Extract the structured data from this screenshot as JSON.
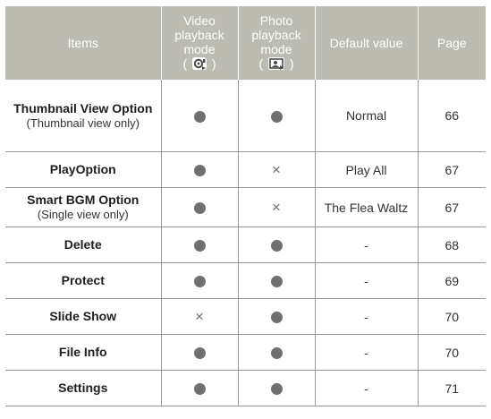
{
  "header": {
    "items": "Items",
    "video_line1": "Video",
    "video_line2": "playback",
    "video_line3": "mode",
    "video_open": "(",
    "video_close": ")",
    "photo_line1": "Photo",
    "photo_line2": "playback",
    "photo_line3": "mode",
    "photo_open": "(",
    "photo_close": ")",
    "default_value": "Default value",
    "page": "Page"
  },
  "symbols": {
    "supported": "dot",
    "unsupported": "×"
  },
  "colors": {
    "header_bg": "#bdbcb2",
    "header_text": "#ffffff",
    "marker": "#6f6f6f"
  },
  "rows": [
    {
      "name": "Thumbnail View Option",
      "note": "(Thumbnail view only)",
      "video": "supported",
      "photo": "supported",
      "default": "Normal",
      "page": "66"
    },
    {
      "name": "PlayOption",
      "note": "",
      "video": "supported",
      "photo": "unsupported",
      "default": "Play All",
      "page": "67"
    },
    {
      "name": "Smart BGM Option",
      "note": "(Single view only)",
      "video": "supported",
      "photo": "unsupported",
      "default": "The Flea Waltz",
      "page": "67"
    },
    {
      "name": "Delete",
      "note": "",
      "video": "supported",
      "photo": "supported",
      "default": "-",
      "page": "68"
    },
    {
      "name": "Protect",
      "note": "",
      "video": "supported",
      "photo": "supported",
      "default": "-",
      "page": "69"
    },
    {
      "name": "Slide Show",
      "note": "",
      "video": "unsupported",
      "photo": "supported",
      "default": "-",
      "page": "70"
    },
    {
      "name": "File Info",
      "note": "",
      "video": "supported",
      "photo": "supported",
      "default": "-",
      "page": "70"
    },
    {
      "name": "Settings",
      "note": "",
      "video": "supported",
      "photo": "supported",
      "default": "-",
      "page": "71"
    }
  ]
}
